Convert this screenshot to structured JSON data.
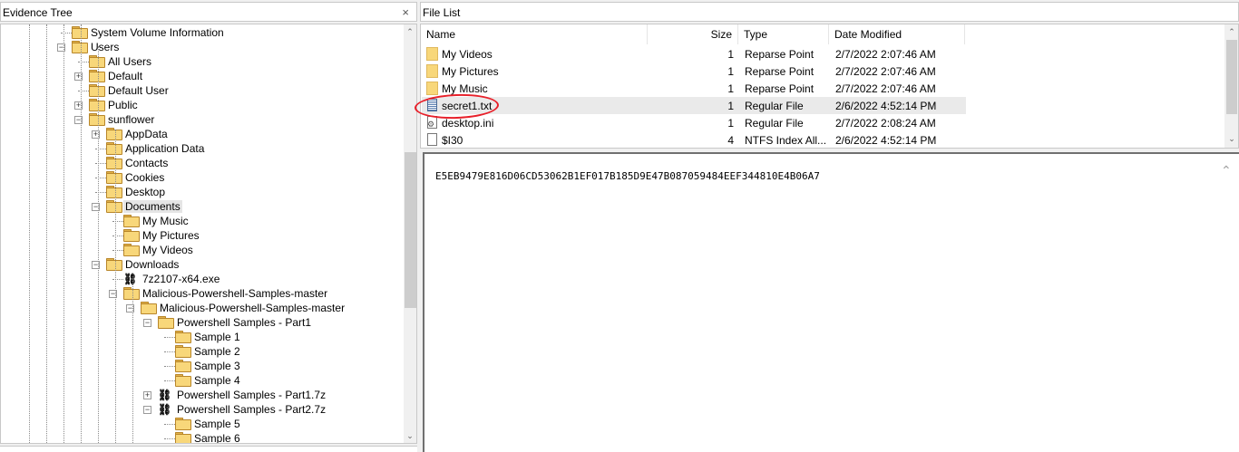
{
  "tree": {
    "title": "Evidence Tree",
    "close_icon": "close-icon",
    "nodes": [
      {
        "label": "System Volume Information",
        "depth": 4,
        "expander": ""
      },
      {
        "label": "Users",
        "depth": 4,
        "expander": "−"
      },
      {
        "label": "All Users",
        "depth": 5,
        "expander": ""
      },
      {
        "label": "Default",
        "depth": 5,
        "expander": "+"
      },
      {
        "label": "Default User",
        "depth": 5,
        "expander": ""
      },
      {
        "label": "Public",
        "depth": 5,
        "expander": "+"
      },
      {
        "label": "sunflower",
        "depth": 5,
        "expander": "−"
      },
      {
        "label": "AppData",
        "depth": 6,
        "expander": "+"
      },
      {
        "label": "Application Data",
        "depth": 6,
        "expander": ""
      },
      {
        "label": "Contacts",
        "depth": 6,
        "expander": ""
      },
      {
        "label": "Cookies",
        "depth": 6,
        "expander": ""
      },
      {
        "label": "Desktop",
        "depth": 6,
        "expander": ""
      },
      {
        "label": "Documents",
        "depth": 6,
        "expander": "−",
        "selected": true
      },
      {
        "label": "My Music",
        "depth": 7,
        "expander": ""
      },
      {
        "label": "My Pictures",
        "depth": 7,
        "expander": ""
      },
      {
        "label": "My Videos",
        "depth": 7,
        "expander": ""
      },
      {
        "label": "Downloads",
        "depth": 6,
        "expander": "−"
      },
      {
        "label": "7z2107-x64.exe",
        "depth": 7,
        "expander": "",
        "icon": "archive"
      },
      {
        "label": "Malicious-Powershell-Samples-master",
        "depth": 7,
        "expander": "−"
      },
      {
        "label": "Malicious-Powershell-Samples-master",
        "depth": 8,
        "expander": "−"
      },
      {
        "label": "Powershell Samples - Part1",
        "depth": 9,
        "expander": "−"
      },
      {
        "label": "Sample 1",
        "depth": 10,
        "expander": ""
      },
      {
        "label": "Sample 2",
        "depth": 10,
        "expander": ""
      },
      {
        "label": "Sample 3",
        "depth": 10,
        "expander": ""
      },
      {
        "label": "Sample 4",
        "depth": 10,
        "expander": ""
      },
      {
        "label": "Powershell Samples - Part1.7z",
        "depth": 9,
        "expander": "+",
        "icon": "archive"
      },
      {
        "label": "Powershell Samples - Part2.7z",
        "depth": 9,
        "expander": "−",
        "icon": "archive"
      },
      {
        "label": "Sample 5",
        "depth": 10,
        "expander": ""
      },
      {
        "label": "Sample 6",
        "depth": 10,
        "expander": ""
      }
    ]
  },
  "file_list": {
    "title": "File List",
    "columns": {
      "name": "Name",
      "size": "Size",
      "type": "Type",
      "date": "Date Modified"
    },
    "rows": [
      {
        "name": "My Videos",
        "size": "1",
        "type": "Reparse Point",
        "date": "2/7/2022 2:07:46 AM",
        "icon": "folder"
      },
      {
        "name": "My Pictures",
        "size": "1",
        "type": "Reparse Point",
        "date": "2/7/2022 2:07:46 AM",
        "icon": "folder"
      },
      {
        "name": "My Music",
        "size": "1",
        "type": "Reparse Point",
        "date": "2/7/2022 2:07:46 AM",
        "icon": "folder"
      },
      {
        "name": "secret1.txt",
        "size": "1",
        "type": "Regular File",
        "date": "2/6/2022 4:52:14 PM",
        "icon": "text-file",
        "highlighted": true
      },
      {
        "name": "desktop.ini",
        "size": "1",
        "type": "Regular File",
        "date": "2/7/2022 2:08:24 AM",
        "icon": "settings-file"
      },
      {
        "name": "$I30",
        "size": "4",
        "type": "NTFS Index All...",
        "date": "2/6/2022 4:52:14 PM",
        "icon": "blank-file"
      }
    ]
  },
  "viewer": {
    "content": "E5EB9479E816D06CD53062B1EF017B185D9E47B087059484EEF344810E4B06A7"
  },
  "colors": {
    "annotation_circle": "#e8202a",
    "folder": "#f8d77a",
    "selection": "#e5e5e5"
  }
}
